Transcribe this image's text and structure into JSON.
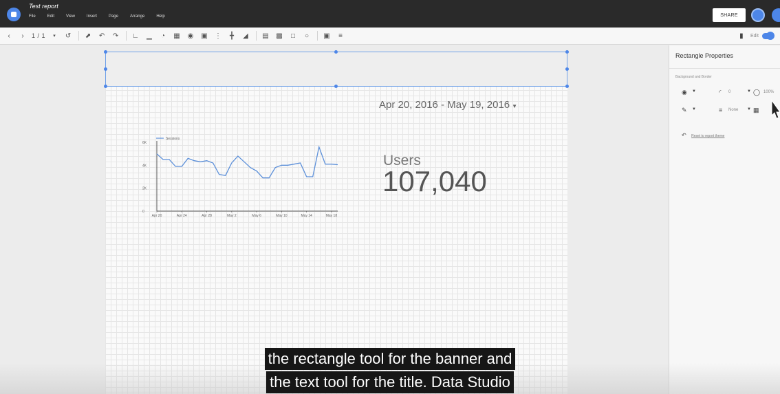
{
  "app": {
    "report_title": "Test report",
    "menu": [
      "File",
      "Edit",
      "View",
      "Insert",
      "Page",
      "Arrange",
      "Help"
    ],
    "share_label": "SHARE"
  },
  "toolbar": {
    "page_indicator": "1 / 1",
    "edit_label": "Edit"
  },
  "report": {
    "date_range": "Apr 20, 2016 - May 19, 2016",
    "scorecard": {
      "label": "Users",
      "value": "107,040"
    }
  },
  "chart_data": {
    "type": "line",
    "title": "",
    "series": [
      {
        "name": "Sessions",
        "values": [
          5000,
          4500,
          4500,
          3900,
          3900,
          4600,
          4400,
          4300,
          4400,
          4200,
          3200,
          3100,
          4200,
          4800,
          4300,
          3800,
          3500,
          2900,
          2900,
          3800,
          4000,
          4000,
          4100,
          4200,
          3000,
          3000,
          5600,
          4100,
          4100,
          4050
        ]
      }
    ],
    "xticks": [
      "Apr 20",
      "Apr 24",
      "Apr 28",
      "May 2",
      "May 6",
      "May 10",
      "May 14",
      "May 18"
    ],
    "yticks": [
      "0",
      "2K",
      "4K",
      "6K"
    ],
    "ylim": [
      0,
      6000
    ],
    "legend": "top-left",
    "color": "#5b8fd9"
  },
  "properties": {
    "title": "Rectangle Properties",
    "section": "Background and Border",
    "border_radius": "0",
    "opacity": "100%",
    "border_style": "None",
    "reset_label": "Reset to report theme"
  },
  "caption": {
    "line1": "the rectangle tool for the banner and",
    "line2": "the text tool for the title. Data Studio"
  }
}
